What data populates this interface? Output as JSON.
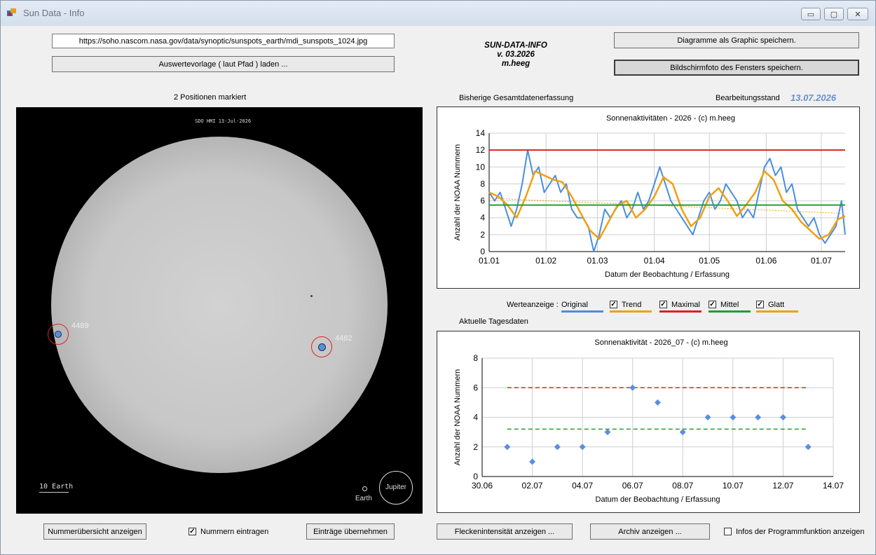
{
  "window": {
    "title": "Sun Data - Info",
    "min_symbol": "▭",
    "max_symbol": "▢",
    "close_symbol": "✕"
  },
  "top": {
    "url_value": "https://soho.nascom.nasa.gov/data/synoptic/sunspots_earth/mdi_sunspots_1024.jpg",
    "load_button": "Auswertevorlage ( laut Pfad ) laden ...",
    "app_name": "SUN-DATA-INFO",
    "version": "v. 03.2026",
    "author": "m.heeg",
    "save_graphic_button": "Diagramme als Graphic speichern.",
    "save_screenshot_button": "Bildschirmfoto des Fensters speichern."
  },
  "left": {
    "positions_label": "2 Positionen markiert",
    "image_header": "SDO HMI  13-Jul-2026",
    "scale_label": "10 Earth",
    "earth_label": "Earth",
    "jupiter_label": "Jupiter",
    "spots": [
      {
        "number": "4489"
      },
      {
        "number": "4482"
      }
    ]
  },
  "right": {
    "total_label": "Bisherige Gesamtdatenerfassung",
    "status_label": "Bearbeitungsstand",
    "status_date": "13.07.2026",
    "values_label": "Werteanzeige :",
    "daily_label": "Aktuelle Tagesdaten"
  },
  "legend": [
    {
      "label": "Original",
      "checkbox": false,
      "color": "#4a8ee0"
    },
    {
      "label": "Trend",
      "checkbox": true,
      "checked": true,
      "color": "#f0a010"
    },
    {
      "label": "Maximal",
      "checkbox": true,
      "checked": true,
      "color": "#e02020"
    },
    {
      "label": "Mittel",
      "checkbox": true,
      "checked": true,
      "color": "#20a030"
    },
    {
      "label": "Glatt",
      "checkbox": true,
      "checked": true,
      "color": "#f0a010"
    }
  ],
  "bottom": {
    "overview_button": "Nummerübersicht anzeigen",
    "enter_numbers_label": "Nummern eintragen",
    "enter_numbers_checked": true,
    "apply_button": "Einträge übernehmen",
    "intensity_button": "Fleckenintensität anzeigen ...",
    "archive_button": "Archiv anzeigen ...",
    "info_label": "Infos der Programmfunktion anzeigen",
    "info_checked": false
  },
  "chart_data": [
    {
      "type": "line",
      "title": "Sonnenaktivitäten - 2026 - (c) m.heeg",
      "xlabel": "Datum der Beobachtung / Erfassung",
      "ylabel": "Anzahl der NOAA Nummern",
      "x_tick_labels": [
        "01.01",
        "01.02",
        "01.03",
        "01.04",
        "01.05",
        "01.06",
        "01.07"
      ],
      "x_tick_days": [
        0,
        31,
        59,
        90,
        120,
        151,
        181
      ],
      "xlim_days": [
        0,
        194
      ],
      "ylim": [
        0,
        14
      ],
      "yticks": [
        0,
        2,
        4,
        6,
        8,
        10,
        12,
        14
      ],
      "grid": true,
      "series": [
        {
          "name": "Original",
          "color": "#4a8ee0",
          "width": 2,
          "x": [
            0,
            3,
            6,
            9,
            12,
            15,
            18,
            21,
            24,
            27,
            30,
            33,
            36,
            39,
            42,
            45,
            48,
            51,
            54,
            57,
            60,
            63,
            66,
            69,
            72,
            75,
            78,
            81,
            84,
            87,
            90,
            93,
            96,
            99,
            102,
            105,
            108,
            111,
            114,
            117,
            120,
            123,
            126,
            129,
            132,
            135,
            138,
            141,
            144,
            147,
            150,
            153,
            156,
            159,
            162,
            165,
            168,
            171,
            174,
            177,
            180,
            183,
            186,
            189,
            192,
            194
          ],
          "y": [
            7,
            6,
            7,
            5,
            3,
            5,
            8,
            12,
            9,
            10,
            7,
            8,
            9,
            7,
            8,
            5,
            4,
            4,
            3,
            0,
            2,
            5,
            4,
            5,
            6,
            4,
            5,
            7,
            5,
            6,
            8,
            10,
            8,
            6,
            5,
            4,
            3,
            2,
            4,
            6,
            7,
            5,
            6,
            8,
            7,
            6,
            4,
            5,
            4,
            7,
            10,
            11,
            9,
            10,
            7,
            8,
            5,
            4,
            3,
            4,
            2,
            1,
            2,
            3,
            6,
            2
          ]
        },
        {
          "name": "Glatt",
          "color": "#f0a010",
          "width": 2.5,
          "x": [
            0,
            5,
            10,
            15,
            20,
            25,
            30,
            35,
            40,
            45,
            50,
            55,
            60,
            65,
            70,
            75,
            80,
            85,
            90,
            95,
            100,
            105,
            110,
            115,
            120,
            125,
            130,
            135,
            140,
            145,
            150,
            155,
            160,
            165,
            170,
            175,
            180,
            185,
            190,
            194
          ],
          "y": [
            7,
            6.5,
            5.5,
            4,
            6.5,
            9.5,
            9,
            8.5,
            8.2,
            6.5,
            4.5,
            2.5,
            1.5,
            3.5,
            5.5,
            6,
            4,
            5,
            6.5,
            8.8,
            8,
            5,
            3,
            4,
            6.5,
            7.5,
            6,
            4.2,
            5.5,
            7,
            9.5,
            8.5,
            6,
            5,
            3.5,
            2.5,
            1.5,
            2,
            3.8,
            4.2
          ]
        },
        {
          "name": "Trend",
          "color": "#f0a010",
          "width": 1,
          "dashed": true,
          "x": [
            0,
            194
          ],
          "y": [
            6.3,
            4.5
          ]
        },
        {
          "name": "Maximal",
          "color": "#e02020",
          "width": 2,
          "x": [
            0,
            194
          ],
          "y": [
            12,
            12
          ]
        },
        {
          "name": "Mittel",
          "color": "#20a030",
          "width": 2,
          "x": [
            0,
            194
          ],
          "y": [
            5.5,
            5.5
          ]
        }
      ]
    },
    {
      "type": "scatter",
      "title": "Sonnenaktivität - 2026_07 - (c) m.heeg",
      "xlabel": "Datum der Beobachtung / Erfassung",
      "ylabel": "Anzahl der NOAA Nummern",
      "x_tick_labels": [
        "30.06",
        "02.07",
        "04.07",
        "06.07",
        "08.07",
        "10.07",
        "12.07",
        "14.07"
      ],
      "x_tick_days": [
        0,
        2,
        4,
        6,
        8,
        10,
        12,
        14
      ],
      "xlim_days": [
        0,
        14
      ],
      "ylim": [
        0,
        8
      ],
      "yticks": [
        0,
        2,
        4,
        6,
        8
      ],
      "grid": true,
      "points": {
        "color": "#5a8fe0",
        "x": [
          1,
          2,
          3,
          4,
          5,
          6,
          7,
          8,
          9,
          10,
          11,
          12,
          13
        ],
        "y": [
          2,
          1,
          2,
          2,
          3,
          6,
          5,
          3,
          4,
          4,
          4,
          4,
          2
        ]
      },
      "lines": [
        {
          "name": "Maximal",
          "color": "#e02020",
          "dashed": true,
          "x": [
            1,
            13
          ],
          "y": [
            6,
            6
          ]
        },
        {
          "name": "Mittel",
          "color": "#20a030",
          "dashed": true,
          "x": [
            1,
            13
          ],
          "y": [
            3.2,
            3.2
          ]
        }
      ]
    }
  ]
}
